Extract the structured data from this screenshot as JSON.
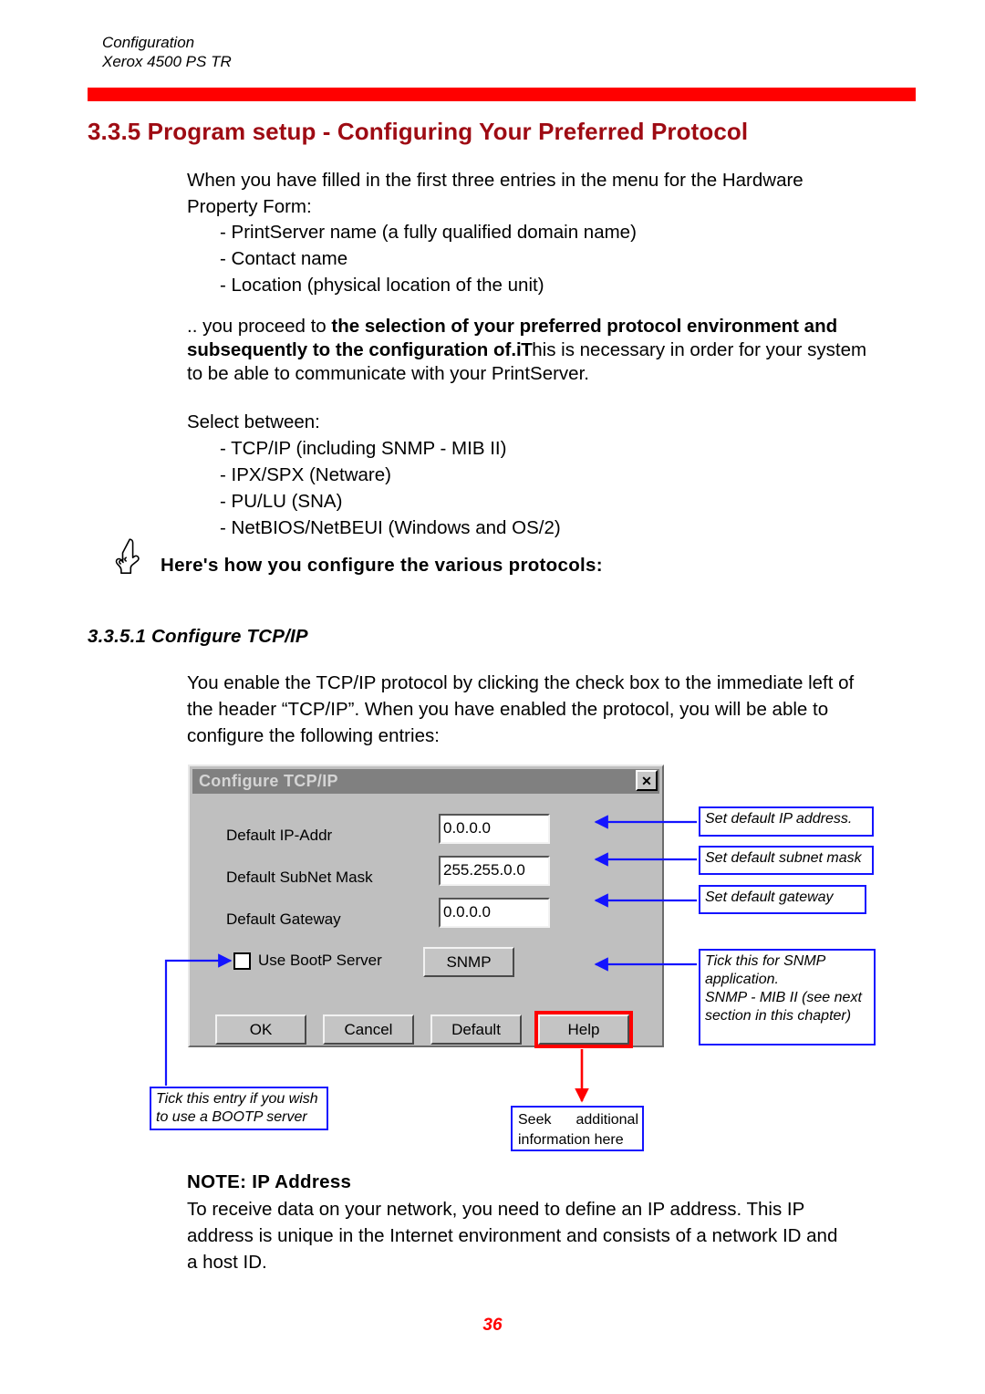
{
  "header": {
    "line1": "Configuration",
    "line2": "Xerox 4500 PS TR"
  },
  "section": {
    "heading": "3.3.5 Program setup - Configuring Your Preferred Protocol"
  },
  "intro": {
    "paragraph": "When you have filled in the first three entries in the menu for the Hardware Property Form:",
    "items": [
      "- PrintServer name (a fully qualified domain name)",
      "- Contact name",
      "- Location (physical location of the unit)"
    ]
  },
  "proceed": {
    "lead": ".. you proceed to ",
    "bold": "the selection of your preferred protocol environment and subsequently to the configuration of.",
    "bold_tail": "iT",
    "tail": "his is necessary in order for your system to be able to communicate with your PrintServer."
  },
  "select": {
    "label": "Select between:",
    "items": [
      "- TCP/IP  (including SNMP - MIB II)",
      "- IPX/SPX (Netware)",
      "- PU/LU (SNA)",
      "- NetBIOS/NetBEUI (Windows and OS/2)"
    ]
  },
  "howto": {
    "text": "Here's how you configure the various protocols:"
  },
  "subsection": {
    "heading": "3.3.5.1 Configure TCP/IP"
  },
  "enable": {
    "paragraph": "You enable the TCP/IP protocol by clicking the check box to the immediate left of the header “TCP/IP”. When you have enabled the protocol, you will be able to configure the following entries:"
  },
  "dialog": {
    "title": "Configure TCP/IP",
    "close_label": "✕",
    "fields": [
      {
        "label": "Default IP-Addr",
        "value": "0.0.0.0"
      },
      {
        "label": "Default SubNet Mask",
        "value": "255.255.0.0"
      },
      {
        "label": "Default Gateway",
        "value": "0.0.0.0"
      }
    ],
    "checkbox": {
      "label": "Use BootP Server",
      "checked": false
    },
    "snmp_button": "SNMP",
    "buttons": [
      "OK",
      "Cancel",
      "Default",
      "Help"
    ]
  },
  "callouts": {
    "ip": "Set default IP address.",
    "subnet": "Set default subnet mask",
    "gateway": "Set default gateway",
    "snmp_line1": "Tick this for SNMP",
    "snmp_line2": "application.",
    "snmp_line3": "SNMP - MIB II (see next",
    "snmp_line4": "section in this chapter)",
    "bootp_line1": "Tick this entry if you wish",
    "bootp_line2": "to use a BOOTP server",
    "seek_line1": "Seek additional",
    "seek_line2": "information here"
  },
  "note": {
    "heading": "NOTE:  IP Address",
    "body": "To receive data on your network, you need to define an IP address. This IP address is unique in the Internet environment and consists of a network ID and a host ID."
  },
  "page": {
    "number": "36"
  },
  "colors": {
    "rule_red": "#ff0000",
    "heading_red": "#9e0b13",
    "callout_blue": "#1414ff",
    "dialog_face": "#bfbfbf",
    "titlebar": "#808080"
  }
}
